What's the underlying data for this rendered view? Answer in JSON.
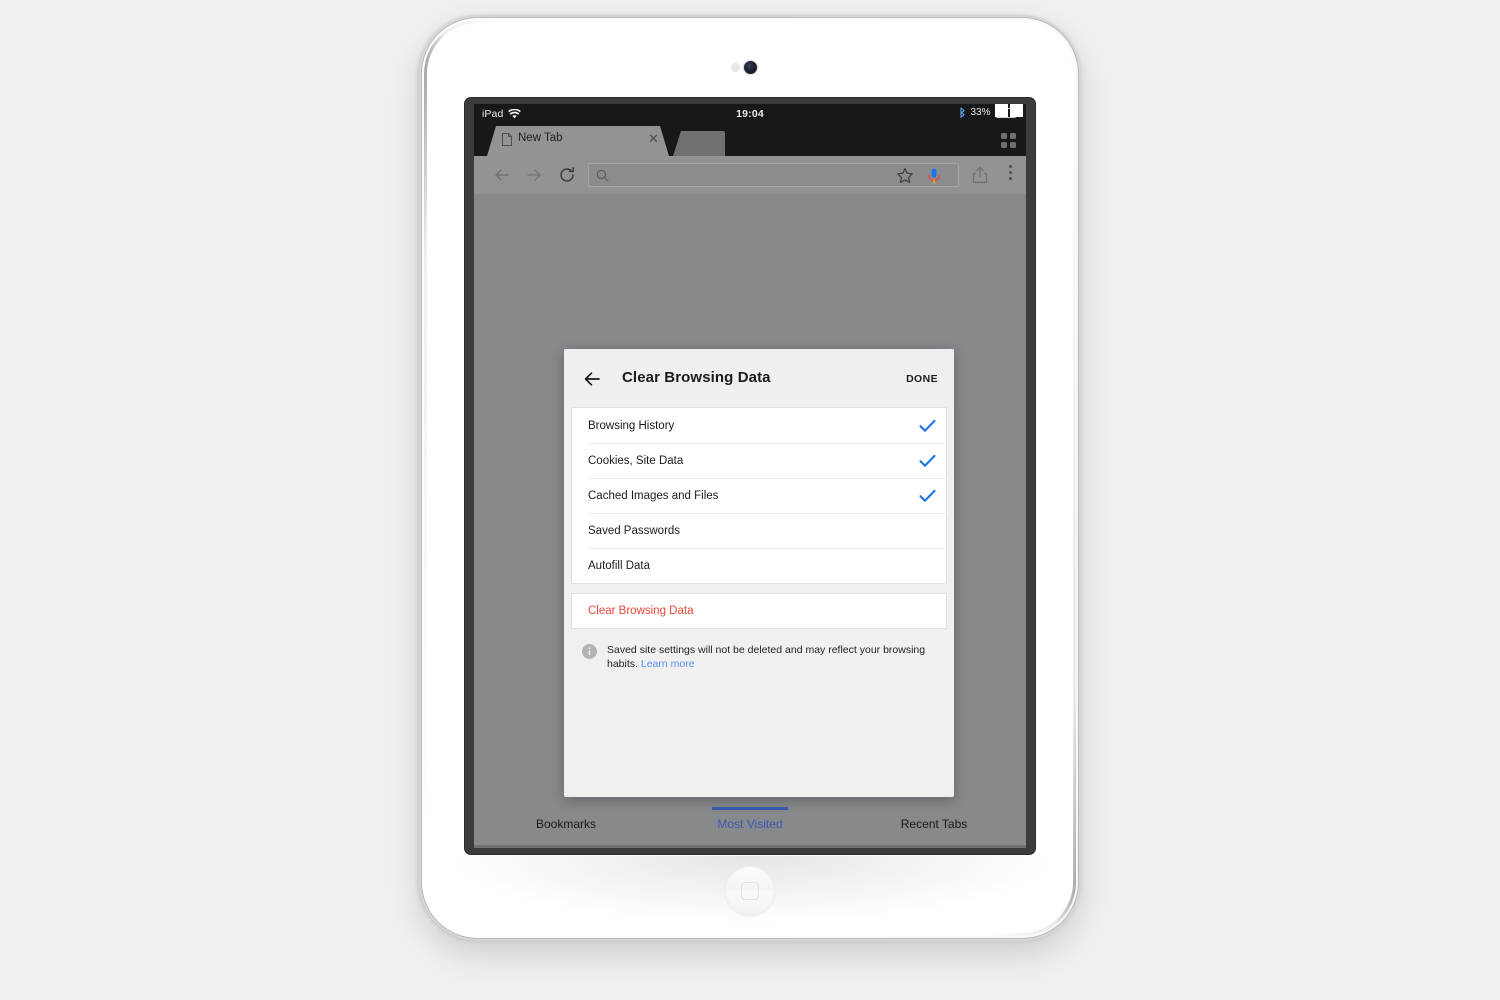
{
  "device": {
    "name": "ipad",
    "camera": "front-camera",
    "home_button": "home-button"
  },
  "status_bar": {
    "device_label": "iPad",
    "wifi_icon": "wifi-icon",
    "clock": "19:04",
    "bluetooth_icon": "bluetooth-icon",
    "battery_percent": "33%",
    "battery_icon": "battery-icon"
  },
  "tab_strip": {
    "tabs": [
      {
        "title": "New Tab",
        "favicon": "page-icon",
        "close_icon": "close-icon",
        "active": true
      }
    ],
    "tab_switcher_icon": "grid-icon"
  },
  "toolbar": {
    "back_icon": "arrow-left-icon",
    "forward_icon": "arrow-right-icon",
    "reload_icon": "reload-icon",
    "omnibox": {
      "search_icon": "search-icon",
      "value": "",
      "placeholder": ""
    },
    "bookmark_icon": "star-icon",
    "voice_icon": "microphone-icon",
    "share_icon": "share-icon",
    "menu_icon": "more-vertical-icon"
  },
  "dialog": {
    "back_icon": "arrow-left-icon",
    "title": "Clear Browsing Data",
    "done_label": "DONE",
    "options": [
      {
        "label": "Browsing History",
        "checked": true
      },
      {
        "label": "Cookies, Site Data",
        "checked": true
      },
      {
        "label": "Cached Images and Files",
        "checked": true
      },
      {
        "label": "Saved Passwords",
        "checked": false
      },
      {
        "label": "Autofill Data",
        "checked": false
      }
    ],
    "action_label": "Clear Browsing Data",
    "footnote": {
      "info_icon": "info-icon",
      "text": "Saved site settings will not be deleted and may reflect your browsing habits. ",
      "link_label": "Learn more"
    }
  },
  "ntp_tabs": [
    {
      "label": "Bookmarks",
      "active": false
    },
    {
      "label": "Most Visited",
      "active": true
    },
    {
      "label": "Recent Tabs",
      "active": false
    }
  ],
  "colors": {
    "scrim": "#87898c",
    "dialog_bg": "#f0f0f0",
    "checkmark_blue": "#1a73e8",
    "destructive_red": "#e8473b",
    "link_blue": "#5b8def",
    "active_tab_blue": "#3b5bb0",
    "status_bar_bg": "#17181a",
    "toolbar_bg": "#919396"
  }
}
